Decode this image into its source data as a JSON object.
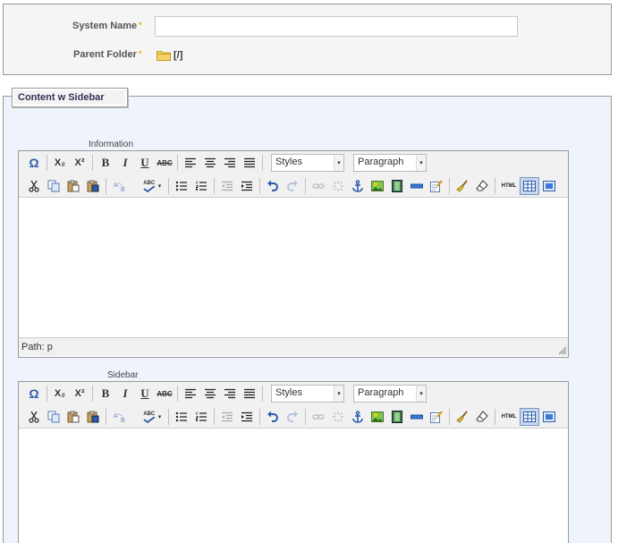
{
  "header": {
    "system_name_label": "System Name",
    "system_name_value": "",
    "parent_folder_label": "Parent Folder",
    "parent_folder_path": "[/]",
    "required_mark": "*"
  },
  "section": {
    "title": "Content w Sidebar"
  },
  "editors": [
    {
      "label": "Information",
      "styles_value": "Styles",
      "format_value": "Paragraph",
      "path_text": "Path: p"
    },
    {
      "label": "Sidebar",
      "styles_value": "Styles",
      "format_value": "Paragraph"
    }
  ],
  "toolbar": {
    "omega": "Ω",
    "subscript": "X₂",
    "superscript": "X²",
    "bold": "B",
    "italic": "I",
    "underline": "U",
    "strike": "ABC",
    "html": "HTML",
    "spell_abc": "ABC",
    "caret": "▾"
  },
  "colors": {
    "panel_bg": "#eff3fb",
    "star": "#e8b800",
    "active_button": "#c7d7ef"
  }
}
